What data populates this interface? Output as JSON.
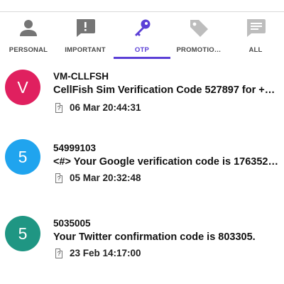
{
  "colors": {
    "accent": "#5b3fd6",
    "tab_icon": "#757575",
    "avatar_pink": "#e0205f",
    "avatar_blue": "#20a4ee",
    "avatar_teal": "#1f9683"
  },
  "tabs": [
    {
      "label": "PERSONAL",
      "icon": "person-icon",
      "active": false
    },
    {
      "label": "IMPORTANT",
      "icon": "important-message-icon",
      "active": false
    },
    {
      "label": "OTP",
      "icon": "key-icon",
      "active": true
    },
    {
      "label": "PROMOTIO…",
      "icon": "tag-icon",
      "active": false
    },
    {
      "label": "ALL",
      "icon": "message-icon",
      "active": false
    }
  ],
  "messages": [
    {
      "avatar_letter": "V",
      "avatar_color": "#e0205f",
      "sender": "VM-CLLFSH",
      "text": "CellFish Sim Verification Code 527897 for +9…",
      "sim": "?",
      "date": "06 Mar 20:44:31"
    },
    {
      "avatar_letter": "5",
      "avatar_color": "#20a4ee",
      "sender": "54999103",
      "text": "<#> Your Google verification code is 176352…",
      "sim": "?",
      "date": "05 Mar 20:32:48"
    },
    {
      "avatar_letter": "5",
      "avatar_color": "#1f9683",
      "sender": "5035005",
      "text": "Your Twitter confirmation code is 803305.",
      "sim": "?",
      "date": "23 Feb 14:17:00"
    }
  ]
}
